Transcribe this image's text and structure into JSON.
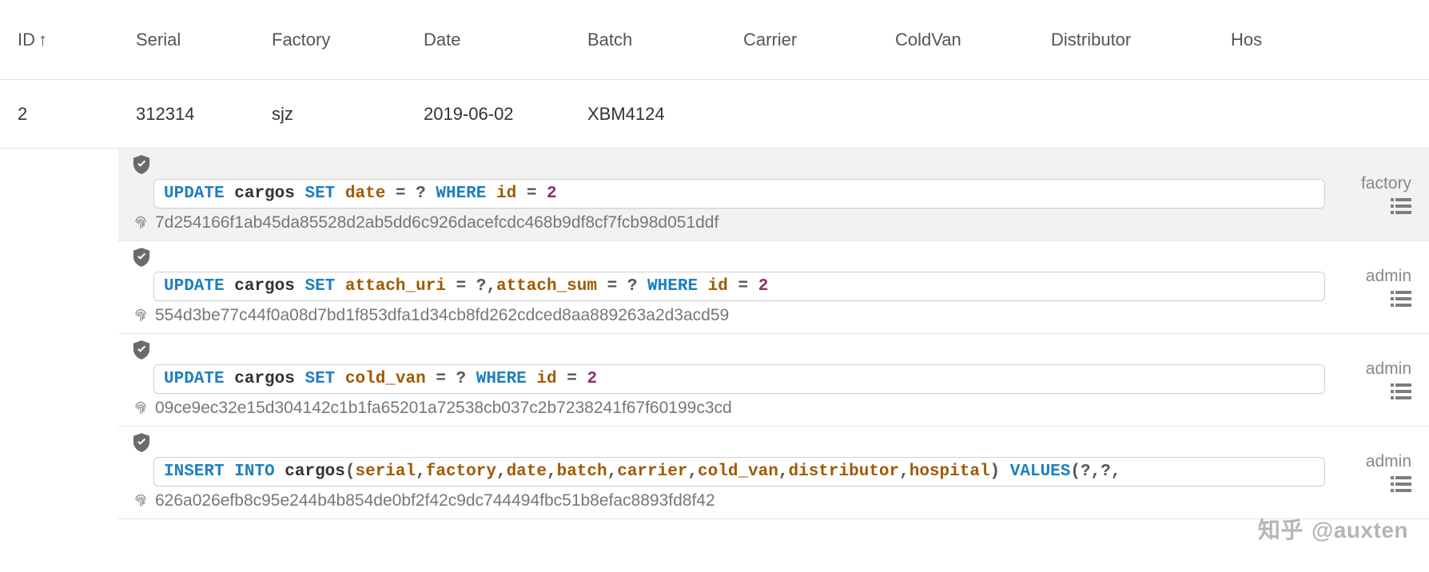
{
  "table": {
    "headers": {
      "id": "ID",
      "serial": "Serial",
      "factory": "Factory",
      "date": "Date",
      "batch": "Batch",
      "carrier": "Carrier",
      "coldvan": "ColdVan",
      "distributor": "Distributor",
      "hospital": "Hos"
    },
    "sort": {
      "column": "id",
      "dir": "asc",
      "glyph": "↑"
    },
    "row": {
      "id": "2",
      "serial": "312314",
      "factory": "sjz",
      "date": "2019-06-02",
      "batch": "XBM4124",
      "carrier": "",
      "coldvan": "",
      "distributor": "",
      "hospital": ""
    }
  },
  "logs": [
    {
      "highlight": true,
      "role": "factory",
      "hash": "7d254166f1ab45da85528d2ab5dd6c926dacefcdc468b9df8cf7fcb98d051ddf",
      "sql_tokens": [
        {
          "t": "kw",
          "v": "UPDATE"
        },
        {
          "t": "sp",
          "v": " "
        },
        {
          "t": "tbl",
          "v": "cargos"
        },
        {
          "t": "sp",
          "v": " "
        },
        {
          "t": "kw",
          "v": "SET"
        },
        {
          "t": "sp",
          "v": " "
        },
        {
          "t": "col",
          "v": "date"
        },
        {
          "t": "sp",
          "v": " "
        },
        {
          "t": "op",
          "v": "="
        },
        {
          "t": "sp",
          "v": " "
        },
        {
          "t": "q",
          "v": "?"
        },
        {
          "t": "sp",
          "v": " "
        },
        {
          "t": "kw",
          "v": "WHERE"
        },
        {
          "t": "sp",
          "v": " "
        },
        {
          "t": "col",
          "v": "id"
        },
        {
          "t": "sp",
          "v": " "
        },
        {
          "t": "op",
          "v": "="
        },
        {
          "t": "sp",
          "v": " "
        },
        {
          "t": "num",
          "v": "2"
        }
      ]
    },
    {
      "highlight": false,
      "role": "admin",
      "hash": "554d3be77c44f0a08d7bd1f853dfa1d34cb8fd262cdced8aa889263a2d3acd59",
      "sql_tokens": [
        {
          "t": "kw",
          "v": "UPDATE"
        },
        {
          "t": "sp",
          "v": " "
        },
        {
          "t": "tbl",
          "v": "cargos"
        },
        {
          "t": "sp",
          "v": " "
        },
        {
          "t": "kw",
          "v": "SET"
        },
        {
          "t": "sp",
          "v": " "
        },
        {
          "t": "col",
          "v": "attach_uri"
        },
        {
          "t": "sp",
          "v": " "
        },
        {
          "t": "op",
          "v": "="
        },
        {
          "t": "sp",
          "v": " "
        },
        {
          "t": "q",
          "v": "?"
        },
        {
          "t": "punc",
          "v": ","
        },
        {
          "t": "col",
          "v": "attach_sum"
        },
        {
          "t": "sp",
          "v": " "
        },
        {
          "t": "op",
          "v": "="
        },
        {
          "t": "sp",
          "v": " "
        },
        {
          "t": "q",
          "v": "?"
        },
        {
          "t": "sp",
          "v": " "
        },
        {
          "t": "kw",
          "v": "WHERE"
        },
        {
          "t": "sp",
          "v": " "
        },
        {
          "t": "col",
          "v": "id"
        },
        {
          "t": "sp",
          "v": " "
        },
        {
          "t": "op",
          "v": "="
        },
        {
          "t": "sp",
          "v": " "
        },
        {
          "t": "num",
          "v": "2"
        }
      ]
    },
    {
      "highlight": false,
      "role": "admin",
      "hash": "09ce9ec32e15d304142c1b1fa65201a72538cb037c2b7238241f67f60199c3cd",
      "sql_tokens": [
        {
          "t": "kw",
          "v": "UPDATE"
        },
        {
          "t": "sp",
          "v": " "
        },
        {
          "t": "tbl",
          "v": "cargos"
        },
        {
          "t": "sp",
          "v": " "
        },
        {
          "t": "kw",
          "v": "SET"
        },
        {
          "t": "sp",
          "v": " "
        },
        {
          "t": "col",
          "v": "cold_van"
        },
        {
          "t": "sp",
          "v": " "
        },
        {
          "t": "op",
          "v": "="
        },
        {
          "t": "sp",
          "v": " "
        },
        {
          "t": "q",
          "v": "?"
        },
        {
          "t": "sp",
          "v": " "
        },
        {
          "t": "kw",
          "v": "WHERE"
        },
        {
          "t": "sp",
          "v": " "
        },
        {
          "t": "col",
          "v": "id"
        },
        {
          "t": "sp",
          "v": " "
        },
        {
          "t": "op",
          "v": "="
        },
        {
          "t": "sp",
          "v": " "
        },
        {
          "t": "num",
          "v": "2"
        }
      ]
    },
    {
      "highlight": false,
      "role": "admin",
      "hash": "626a026efb8c95e244b4b854de0bf2f42c9dc744494fbc51b8efac8893fd8f42",
      "sql_tokens": [
        {
          "t": "kw",
          "v": "INSERT"
        },
        {
          "t": "sp",
          "v": " "
        },
        {
          "t": "kw",
          "v": "INTO"
        },
        {
          "t": "sp",
          "v": " "
        },
        {
          "t": "tbl",
          "v": "cargos"
        },
        {
          "t": "punc",
          "v": "("
        },
        {
          "t": "col",
          "v": "serial"
        },
        {
          "t": "punc",
          "v": ","
        },
        {
          "t": "col",
          "v": "factory"
        },
        {
          "t": "punc",
          "v": ","
        },
        {
          "t": "col",
          "v": "date"
        },
        {
          "t": "punc",
          "v": ","
        },
        {
          "t": "col",
          "v": "batch"
        },
        {
          "t": "punc",
          "v": ","
        },
        {
          "t": "col",
          "v": "carrier"
        },
        {
          "t": "punc",
          "v": ","
        },
        {
          "t": "col",
          "v": "cold_van"
        },
        {
          "t": "punc",
          "v": ","
        },
        {
          "t": "col",
          "v": "distributor"
        },
        {
          "t": "punc",
          "v": ","
        },
        {
          "t": "col",
          "v": "hospital"
        },
        {
          "t": "punc",
          "v": ")"
        },
        {
          "t": "sp",
          "v": " "
        },
        {
          "t": "kw",
          "v": "VALUES"
        },
        {
          "t": "punc",
          "v": "("
        },
        {
          "t": "q",
          "v": "?"
        },
        {
          "t": "punc",
          "v": ","
        },
        {
          "t": "q",
          "v": "?"
        },
        {
          "t": "punc",
          "v": ","
        }
      ]
    }
  ],
  "watermark": {
    "zhihu": "知乎",
    "handle": "@auxten"
  }
}
